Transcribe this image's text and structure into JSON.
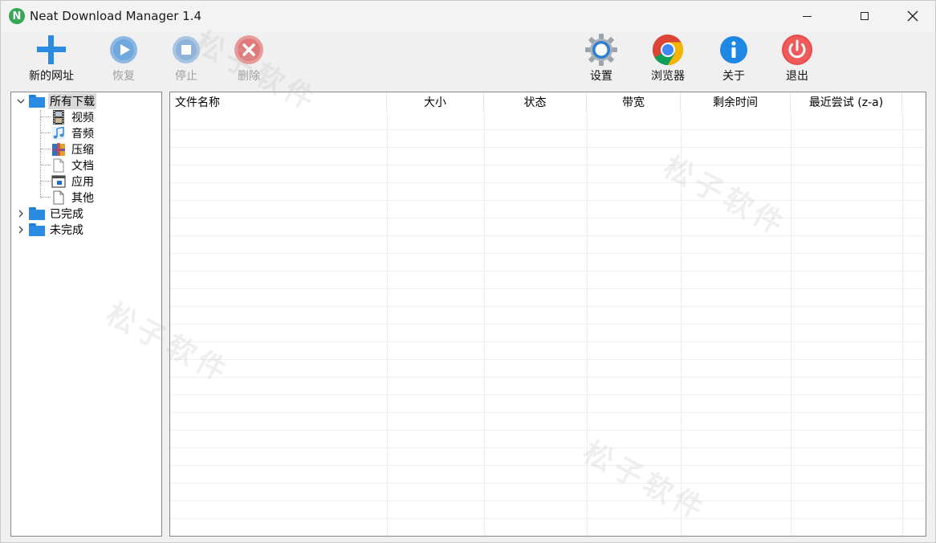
{
  "window": {
    "title": "Neat Download Manager 1.4",
    "app_icon_letter": "N"
  },
  "toolbar": {
    "new_url": "新的网址",
    "resume": "恢复",
    "stop": "停止",
    "delete": "删除",
    "settings": "设置",
    "browser": "浏览器",
    "about": "关于",
    "exit": "退出"
  },
  "tree": {
    "all_downloads": "所有下载",
    "video": "视频",
    "audio": "音频",
    "compressed": "压缩",
    "documents": "文档",
    "applications": "应用",
    "other": "其他",
    "completed": "已完成",
    "incomplete": "未完成"
  },
  "list": {
    "columns": [
      "文件名称",
      "大小",
      "状态",
      "带宽",
      "剩余时间",
      "最近尝试 (z-a)"
    ],
    "rows": []
  },
  "watermark": "松子软件",
  "colors": {
    "accent": "#2a8be0",
    "new_url_plus": "#2a8be0",
    "resume_disabled": "#6fa8dc",
    "stop_disabled": "#8fb3d8",
    "delete_disabled": "#e07a7a",
    "exit": "#e94a4a",
    "about": "#1e88e5"
  }
}
